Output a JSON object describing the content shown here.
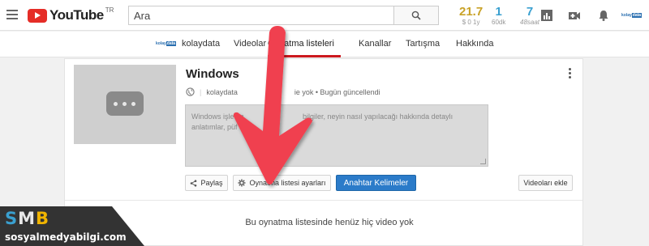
{
  "header": {
    "logo_text": "YouTube",
    "logo_country": "TR",
    "search_placeholder": "Ara",
    "stats": [
      {
        "value": "21.7",
        "label": "$ 0 1y"
      },
      {
        "value": "1",
        "label": "60dk"
      },
      {
        "value": "7",
        "label": "48saat"
      }
    ],
    "avatar_text_a": "kolay",
    "avatar_text_b": "data"
  },
  "channel_nav": {
    "logo_a": "kolay",
    "logo_b": "data",
    "items": [
      "kolaydata",
      "Videolar",
      "Oynatma listeleri",
      "Kanallar",
      "Tartışma",
      "Hakkında"
    ],
    "active_index": 2
  },
  "playlist": {
    "title": "Windows",
    "channel": "kolaydata",
    "video_count": "ie yok",
    "updated": "Bugün güncellendi",
    "description_placeholder_line1": "Windows işletim                             bilgiler, neyin nasıl yapılacağı hakkında detaylı",
    "description_placeholder_line2": "anlatımlar, püf no",
    "buttons": {
      "share": "Paylaş",
      "settings": "Oynatma listesi ayarları",
      "keywords": "Anahtar Kelimeler",
      "add_videos": "Videoları ekle"
    },
    "empty_message": "Bu oynatma listesinde henüz hiç video yok"
  },
  "watermark": {
    "letter_s": "S",
    "letter_m": "M",
    "letter_b": "B",
    "domain": "sosyalmedyabilgi.com"
  },
  "colors": {
    "youtube_red": "#e52d27",
    "arrow_red": "#f0404f",
    "primary_blue": "#2b7bc9"
  }
}
